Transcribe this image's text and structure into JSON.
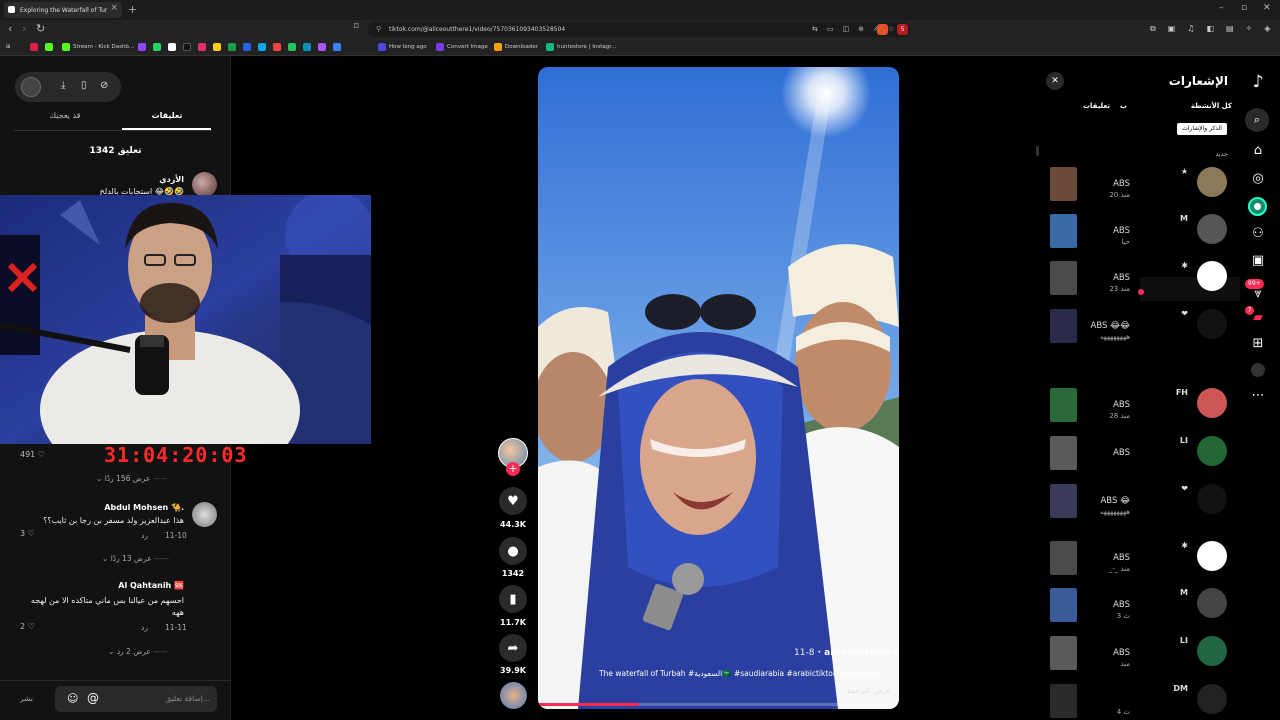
{
  "browser": {
    "tab_title": "Exploring the Waterfall of Tur",
    "url": "tiktok.com/@aliceoutthere1/video/7570361093403528504",
    "bookmarks": [
      "Stream - Kick Dashb...",
      "How long ago",
      "Convert Image",
      "Downloader",
      "huntostore | Instagr..."
    ],
    "badge_count": "5"
  },
  "comments_panel": {
    "tab_comments": "تعليقات",
    "tab_liked": "قد يعجبك",
    "count_label": "1342 تعليق",
    "c1_name": "الأزدي",
    "c1_text": "استجابات بالدلخ 😂🤣🤣",
    "c1_likes": "491",
    "c1_replies": "عرض 156 ردًا",
    "c2_name": "Abdul Mohsen 🐪.",
    "c2_text": "هذا عبدالعزيز ولد مسفر بن رجا بن ثايب؟؟",
    "c2_date": "11-10",
    "c2_reply": "رد",
    "c2_likes": "3",
    "c2_replies": "عرض 13 ردًا",
    "c3_name": "Al Qahtanih 🆘",
    "c3_text_1": "احسهم من عيالنا بس ماني متاكده الا من لهجه",
    "c3_text_2": "ههه",
    "c3_date": "11-11",
    "c3_reply": "رد",
    "c3_likes": "2",
    "c3_replies": "عرض 2 رد",
    "input_placeholder": "إضافة تعليق...",
    "post_label": "نشر",
    "timer": "31:04:20:03"
  },
  "video": {
    "author": "aliceoutthere1",
    "date": "11-8",
    "caption": "The waterfall of Turbah #السعودية🇸🇦 #saudiarabia #arabictiktok #visitsaudi ...",
    "translate": "عرض الترجمة",
    "likes": "44.3K",
    "comments": "1342",
    "saves": "11.7K",
    "shares": "39.9K",
    "progress": 0.28
  },
  "notifications": {
    "title": "الإشعارات",
    "filter_all": "كل الأنشطة",
    "filter_comments": "تعليقات",
    "filter_mentions": "الذكر والإشارات",
    "filter_b": "ب",
    "section_new": "جديد",
    "rows": [
      {
        "name": "ABS",
        "sub": "20 منذ",
        "mark": "★"
      },
      {
        "name": "ABS",
        "sub": "حيا",
        "mark": "M"
      },
      {
        "name": "ABS",
        "sub": "23 منذ",
        "mark": "✱"
      },
      {
        "name": "ABS 😂😂",
        "sub": "ههههههههه",
        "mark": "❤"
      },
      {
        "name": "ABS",
        "sub": "28 منذ",
        "mark": "FH"
      },
      {
        "name": "ABS",
        "sub": "",
        "mark": "LI"
      },
      {
        "name": "ABS 😂",
        "sub": "ههههههههه",
        "mark": "❤"
      },
      {
        "name": "ABS",
        "sub": "_-_ منذ",
        "mark": "✱"
      },
      {
        "name": "ABS",
        "sub": "3 ث",
        "mark": "M"
      },
      {
        "name": "ABS",
        "sub": "منذ",
        "mark": "LI"
      },
      {
        "name": "",
        "sub": "4 ث",
        "mark": "DM"
      }
    ],
    "badge_inbox": "99+",
    "badge_msgs": "7"
  }
}
